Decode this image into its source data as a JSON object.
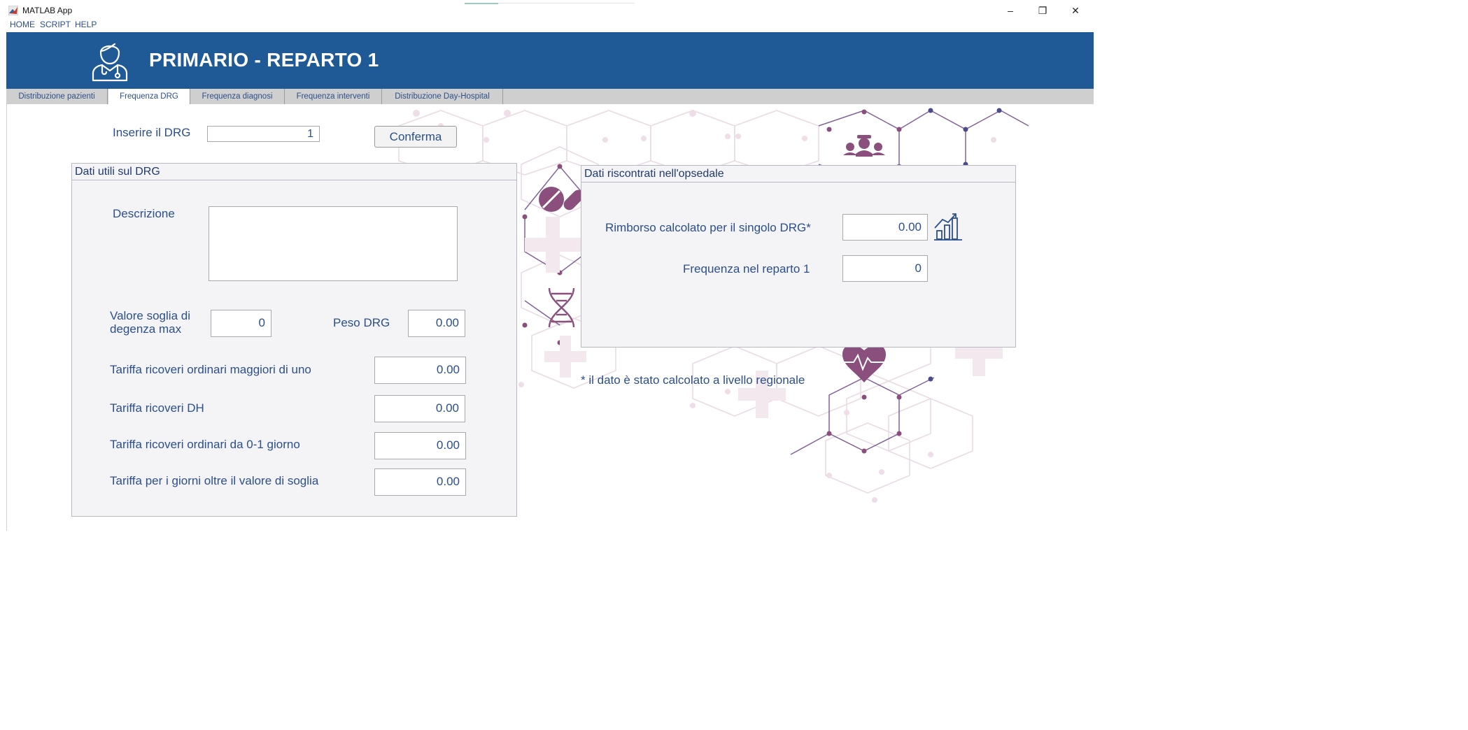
{
  "window": {
    "title": "MATLAB App",
    "minimize": "–",
    "restore": "❐",
    "close": "✕"
  },
  "menu": {
    "items": [
      "HOME",
      "SCRIPT",
      "HELP"
    ]
  },
  "header": {
    "title": "PRIMARIO - REPARTO 1",
    "icon": "doctor-icon"
  },
  "tabs": [
    {
      "label": "Distribuzione pazienti",
      "active": false
    },
    {
      "label": "Frequenza DRG",
      "active": true
    },
    {
      "label": "Frequenza diagnosi",
      "active": false
    },
    {
      "label": "Frequenza interventi",
      "active": false
    },
    {
      "label": "Distribuzione Day-Hospital",
      "active": false
    }
  ],
  "drg_input": {
    "label": "Inserire il DRG",
    "value": "1",
    "confirm_label": "Conferma"
  },
  "panel_left": {
    "title": "Dati utili sul DRG",
    "descrizione_label": "Descrizione",
    "descrizione_value": "",
    "soglia_label_line1": "Valore soglia di",
    "soglia_label_line2": "degenza max",
    "soglia_value": "0",
    "peso_label": "Peso DRG",
    "peso_value": "0.00",
    "tariffa_maggiori_label": "Tariffa ricoveri ordinari maggiori di uno",
    "tariffa_maggiori_value": "0.00",
    "tariffa_dh_label": "Tariffa ricoveri DH",
    "tariffa_dh_value": "0.00",
    "tariffa_01_label": "Tariffa ricoveri ordinari da 0-1 giorno",
    "tariffa_01_value": "0.00",
    "tariffa_oltre_label": "Tariffa per i giorni oltre il valore di soglia",
    "tariffa_oltre_value": "0.00"
  },
  "panel_right": {
    "title": "Dati riscontrati nell'opsedale",
    "rimborso_label": "Rimborso calcolato per il singolo DRG*",
    "rimborso_value": "0.00",
    "frequenza_label": "Frequenza nel reparto 1",
    "frequenza_value": "0",
    "chart_icon": "bar-chart-icon"
  },
  "footnote": "* il dato è stato calcolato a livello regionale",
  "colors": {
    "header_blue": "#1f5a97",
    "label_blue": "#2b4f8a",
    "accent_purple": "#8a4f7d",
    "navy": "#4a4a8c"
  }
}
